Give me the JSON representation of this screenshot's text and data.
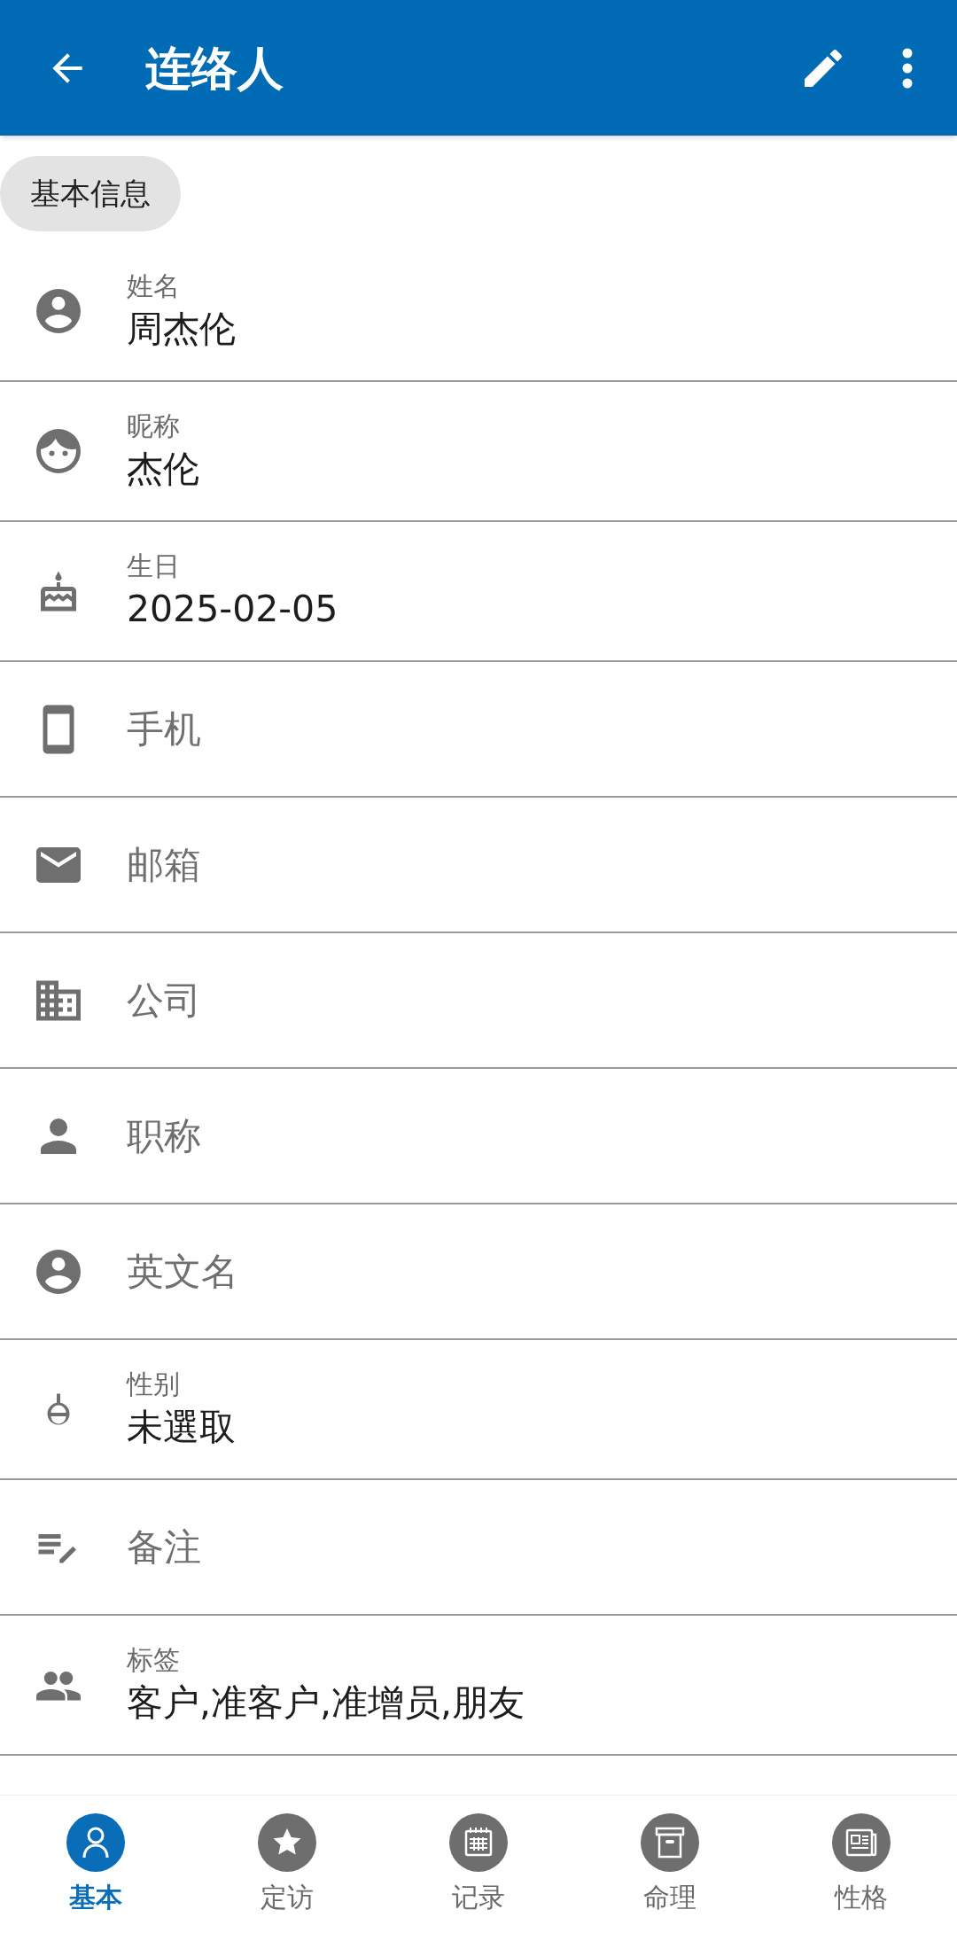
{
  "app_bar": {
    "title": "连络人"
  },
  "section_chip": "基本信息",
  "fields": [
    {
      "label": "姓名",
      "value": "周杰伦"
    },
    {
      "label": "昵称",
      "value": "杰伦"
    },
    {
      "label": "生日",
      "value": "2025-02-05"
    },
    {
      "label": "手机"
    },
    {
      "label": "邮箱"
    },
    {
      "label": "公司"
    },
    {
      "label": "职称"
    },
    {
      "label": "英文名"
    },
    {
      "label": "性别",
      "value": "未選取"
    },
    {
      "label": "备注"
    },
    {
      "label": "标签",
      "value": "客户,准客户,准增员,朋友"
    }
  ],
  "bottom_nav": [
    {
      "label": "基本",
      "selected": true
    },
    {
      "label": "定访",
      "selected": false
    },
    {
      "label": "记录",
      "selected": false
    },
    {
      "label": "命理",
      "selected": false
    },
    {
      "label": "性格",
      "selected": false
    }
  ]
}
